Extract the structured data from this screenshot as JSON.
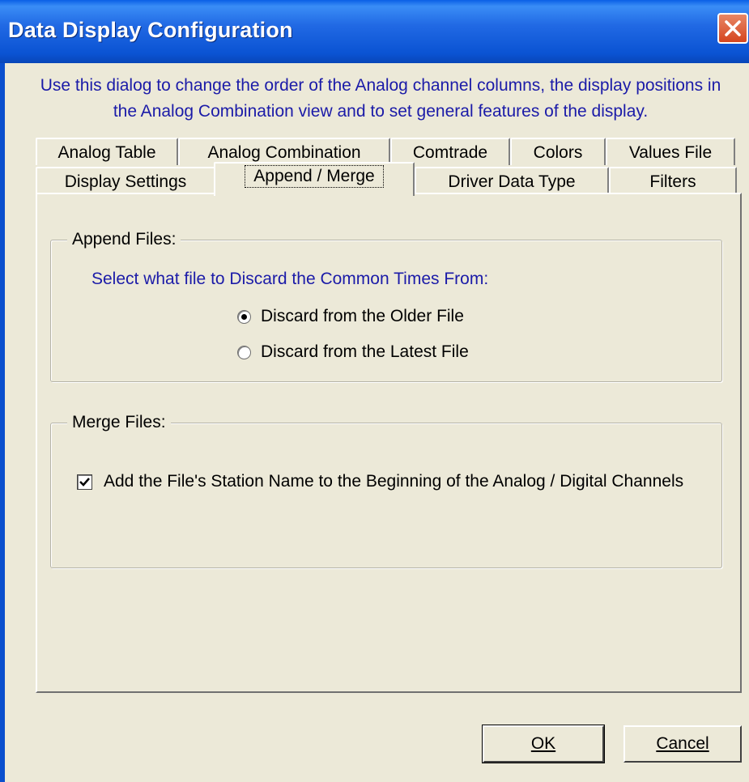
{
  "window": {
    "title": "Data Display Configuration",
    "description": "Use this dialog to change the order of the Analog channel columns, the display positions in the Analog Combination view and to set general features of the display."
  },
  "tabs_row1": [
    {
      "label": "Analog Table"
    },
    {
      "label": "Analog Combination"
    },
    {
      "label": "Comtrade"
    },
    {
      "label": "Colors"
    },
    {
      "label": "Values File"
    }
  ],
  "tabs_row2": [
    {
      "label": "Display Settings"
    },
    {
      "label": "Append / Merge",
      "active": true
    },
    {
      "label": "Driver Data Type"
    },
    {
      "label": "Filters"
    }
  ],
  "append_group": {
    "legend": "Append Files:",
    "prompt": "Select what file to Discard the Common Times From:",
    "options": [
      {
        "label": "Discard from the Older File",
        "selected": true
      },
      {
        "label": "Discard from the Latest File",
        "selected": false
      }
    ]
  },
  "merge_group": {
    "legend": "Merge Files:",
    "checkbox_label": "Add the File's Station Name to the Beginning of the Analog / Digital Channels",
    "checked": true
  },
  "buttons": {
    "ok_label": "OK",
    "cancel_label": "Cancel"
  },
  "colors": {
    "titlebar": "#0a53d3",
    "description_text": "#1b1ba8",
    "dialog_background": "#ece9d8",
    "close_button": "#d5461f"
  },
  "icons": {
    "close": "close-icon",
    "check": "checkmark-icon"
  }
}
